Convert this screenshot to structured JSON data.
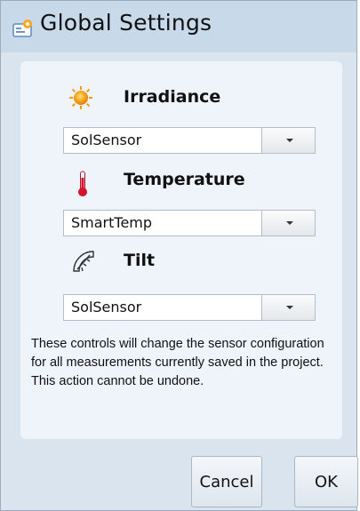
{
  "window": {
    "title": "Global Settings",
    "title_icon": "settings-window-icon"
  },
  "sections": [
    {
      "label": "Irradiance",
      "icon": "sun-icon",
      "selected": "SolSensor"
    },
    {
      "label": "Temperature",
      "icon": "thermometer-icon",
      "selected": "SmartTemp"
    },
    {
      "label": "Tilt",
      "icon": "protractor-icon",
      "selected": "SolSensor"
    }
  ],
  "note": "These controls will change the sensor configuration for all measurements currently saved in the project. This action cannot be undone.",
  "buttons": {
    "cancel": "Cancel",
    "ok": "OK"
  },
  "colors": {
    "background": "#d9e4ef",
    "panel": "#eef4fa",
    "titlebar": "#c8d9ea"
  }
}
